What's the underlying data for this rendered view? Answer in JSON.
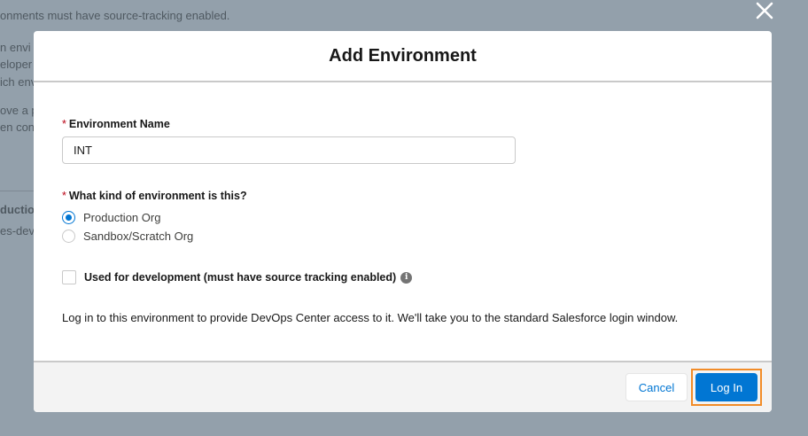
{
  "background": {
    "fragments": [
      {
        "text": "onments must have source-tracking enabled.",
        "bold": false
      },
      {
        "text": "n envi",
        "bold": false
      },
      {
        "text": "eloper",
        "bold": false
      },
      {
        "text": "ich env",
        "bold": false
      },
      {
        "text": "ove a p",
        "bold": false
      },
      {
        "text": "en con",
        "bold": false
      },
      {
        "text": "duction",
        "bold": true
      },
      {
        "text": "es-dev",
        "bold": false
      }
    ]
  },
  "modal": {
    "title": "Add Environment",
    "environment_name": {
      "required_mark": "*",
      "label": "Environment Name",
      "value": "INT"
    },
    "environment_kind": {
      "required_mark": "*",
      "label": "What kind of environment is this?",
      "options": [
        {
          "label": "Production Org",
          "selected": true
        },
        {
          "label": "Sandbox/Scratch Org",
          "selected": false
        }
      ]
    },
    "development_checkbox": {
      "label": "Used for development (must have source tracking enabled)",
      "checked": false,
      "info_icon": "info-icon"
    },
    "description": "Log in to this environment to provide DevOps Center access to it. We'll take you to the standard Salesforce login window.",
    "footer": {
      "cancel_label": "Cancel",
      "login_label": "Log In"
    }
  },
  "colors": {
    "brand": "#0176d3",
    "highlight": "#f28c28",
    "required": "#ba0517",
    "overlay": "#93a0ab"
  }
}
